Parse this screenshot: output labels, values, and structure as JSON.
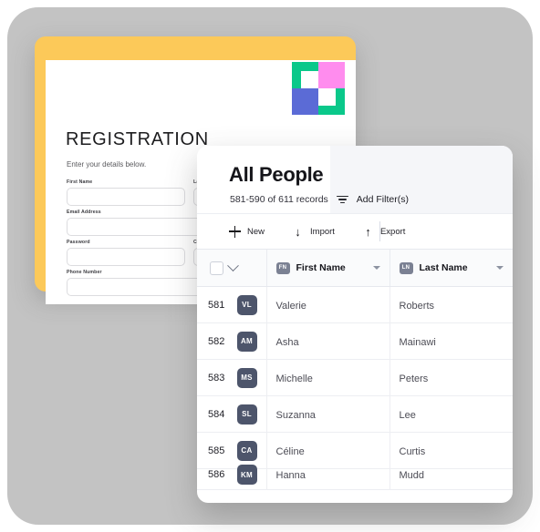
{
  "registration": {
    "title": "REGISTRATION",
    "subtitle": "Enter your details below.",
    "fields": [
      {
        "label": "First Name"
      },
      {
        "label": "Last Name"
      },
      {
        "label": "Email Address"
      },
      {
        "label": "Password"
      },
      {
        "label": "Confirm Password"
      },
      {
        "label": "Phone Number"
      }
    ],
    "logo": {
      "name": "app-logo",
      "colors": {
        "green": "#0ac88a",
        "pink": "#ff8cee",
        "blue": "#5b6bd6"
      }
    },
    "frame_color": "#fcc959"
  },
  "grid": {
    "title": "All People",
    "record_count": "581-590 of 611 records",
    "filter_label": "Add Filter(s)",
    "toolbar": [
      {
        "label": "New",
        "icon": "plus-icon"
      },
      {
        "label": "Import",
        "icon": "arrow-down-icon",
        "glyph": "↓"
      },
      {
        "label": "Export",
        "icon": "arrow-up-icon",
        "glyph": "↑"
      }
    ],
    "columns": [
      {
        "badge": "FN",
        "label": "First Name"
      },
      {
        "badge": "LN",
        "label": "Last Name"
      }
    ],
    "rows": [
      {
        "num": "581",
        "initials": "VL",
        "first_name": "Valerie",
        "last_name": "Roberts"
      },
      {
        "num": "582",
        "initials": "AM",
        "first_name": "Asha",
        "last_name": "Mainawi"
      },
      {
        "num": "583",
        "initials": "MS",
        "first_name": "Michelle",
        "last_name": "Peters"
      },
      {
        "num": "584",
        "initials": "SL",
        "first_name": "Suzanna",
        "last_name": "Lee"
      },
      {
        "num": "585",
        "initials": "CA",
        "first_name": "Céline",
        "last_name": "Curtis"
      },
      {
        "num": "586",
        "initials": "KM",
        "first_name": "Hanna",
        "last_name": "Mudd"
      }
    ],
    "accent_color": "#4d556b",
    "badge_color": "#7b8193"
  }
}
